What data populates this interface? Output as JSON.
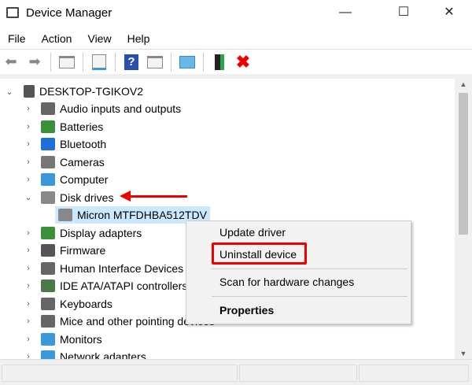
{
  "window": {
    "title": "Device Manager",
    "minimize": "—",
    "maximize": "☐",
    "close": "✕"
  },
  "menu": [
    "File",
    "Action",
    "View",
    "Help"
  ],
  "toolbar": [
    "back-icon",
    "forward-icon",
    "properties-pane-icon",
    "device-list-icon",
    "help-icon",
    "show-pane-icon",
    "scan-hardware-icon",
    "update-driver-icon",
    "uninstall-icon"
  ],
  "tree": {
    "root": "DESKTOP-TGIKOV2",
    "items": [
      {
        "label": "Audio inputs and outputs",
        "color": "#666"
      },
      {
        "label": "Batteries",
        "color": "#3a8f3a"
      },
      {
        "label": "Bluetooth",
        "color": "#1e6fd9"
      },
      {
        "label": "Cameras",
        "color": "#777"
      },
      {
        "label": "Computer",
        "color": "#3a9ad9"
      },
      {
        "label": "Disk drives",
        "color": "#888",
        "expanded": true
      },
      {
        "label": "Micron MTFDHBA512TDV",
        "color": "#888",
        "child": true,
        "selected": true
      },
      {
        "label": "Display adapters",
        "color": "#3a8f3a"
      },
      {
        "label": "Firmware",
        "color": "#555"
      },
      {
        "label": "Human Interface Devices",
        "color": "#666"
      },
      {
        "label": "IDE ATA/ATAPI controllers",
        "color": "#4a7a4a"
      },
      {
        "label": "Keyboards",
        "color": "#666"
      },
      {
        "label": "Mice and other pointing devices",
        "color": "#666"
      },
      {
        "label": "Monitors",
        "color": "#3a9ad9"
      },
      {
        "label": "Network adapters",
        "color": "#3a9ad9"
      }
    ]
  },
  "context_menu": {
    "update": "Update driver",
    "uninstall": "Uninstall device",
    "scan": "Scan for hardware changes",
    "properties": "Properties"
  }
}
